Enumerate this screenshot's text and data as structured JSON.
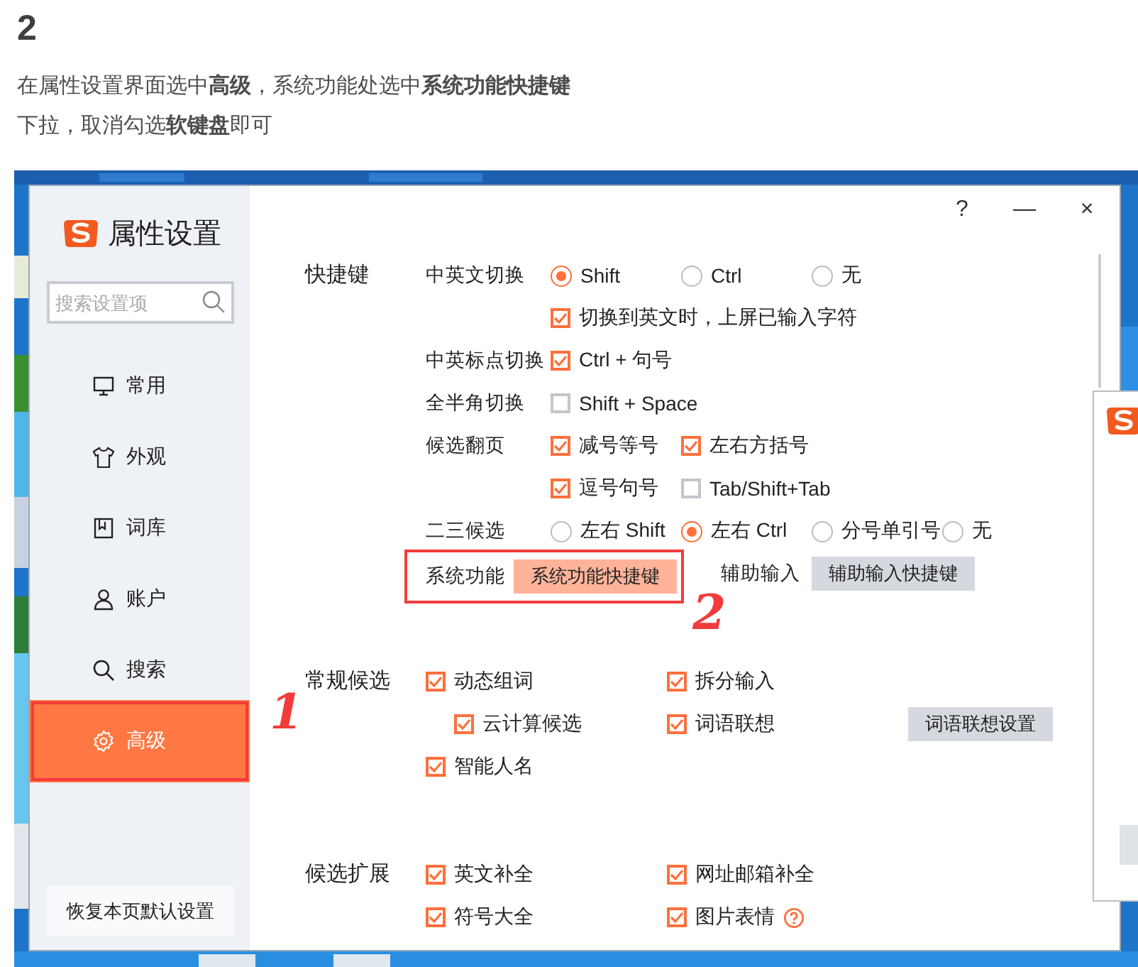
{
  "article": {
    "heading": "2",
    "lines": [
      "在属性设置界面选中**高级**，系统功能处选中**系统功能快捷键**",
      "下拉，取消勾选**软键盘**即可"
    ]
  },
  "dialog": {
    "title": "属性设置",
    "window_buttons": [
      "?",
      "—",
      "×"
    ],
    "search": {
      "placeholder": "搜索设置项"
    },
    "nav": [
      {
        "label": "常用",
        "selected": false,
        "outlined": false
      },
      {
        "label": "外观",
        "selected": false,
        "outlined": false
      },
      {
        "label": "词库",
        "selected": false,
        "outlined": false
      },
      {
        "label": "账户",
        "selected": false,
        "outlined": false
      },
      {
        "label": "搜索",
        "selected": false,
        "outlined": false
      },
      {
        "label": "高级",
        "selected": true,
        "outlined": true
      }
    ],
    "reset_button": "恢复本页默认设置",
    "sections": [
      {
        "label": "快捷键",
        "rows": [
          {
            "label": "中英文切换",
            "options": [
              {
                "kind": "radio",
                "label": "Shift",
                "checked": true
              },
              {
                "kind": "radio",
                "label": "Ctrl",
                "checked": false
              },
              {
                "kind": "radio",
                "label": "无",
                "checked": false
              }
            ]
          },
          {
            "options": [
              {
                "kind": "checkbox",
                "label": "切换到英文时，上屏已输入字符",
                "checked": true
              }
            ]
          },
          {
            "label": "中英标点切换",
            "options": [
              {
                "kind": "checkbox",
                "label": "Ctrl + 句号",
                "checked": true
              }
            ]
          },
          {
            "label": "全半角切换",
            "options": [
              {
                "kind": "checkbox",
                "label": "Shift + Space",
                "checked": false
              }
            ]
          },
          {
            "label": "候选翻页",
            "options": [
              {
                "kind": "checkbox",
                "label": "减号等号",
                "checked": true
              },
              {
                "kind": "checkbox",
                "label": "左右方括号",
                "checked": true
              }
            ]
          },
          {
            "options": [
              {
                "kind": "checkbox",
                "label": "逗号句号",
                "checked": true
              },
              {
                "kind": "checkbox",
                "label": "Tab/Shift+Tab",
                "checked": false
              }
            ]
          },
          {
            "label": "二三候选",
            "options": [
              {
                "kind": "radio",
                "label": "左右 Shift",
                "checked": false
              },
              {
                "kind": "radio",
                "label": "左右 Ctrl",
                "checked": true
              },
              {
                "kind": "radio",
                "label": "分号单引号",
                "checked": false
              },
              {
                "kind": "radio",
                "label": "无",
                "checked": false
              }
            ]
          },
          {
            "label": "系统功能",
            "outlined": true,
            "options": [
              {
                "kind": "button",
                "label": "系统功能快捷键",
                "highlighted": true
              },
              {
                "kind": "text",
                "label": "辅助输入"
              },
              {
                "kind": "button",
                "label": "辅助输入快捷键",
                "highlighted": false
              }
            ]
          }
        ]
      },
      {
        "label": "常规候选",
        "rows": [
          {
            "options": [
              {
                "kind": "checkbox",
                "label": "动态组词",
                "checked": true
              },
              {
                "kind": "checkbox",
                "label": "拆分输入",
                "checked": true
              }
            ]
          },
          {
            "options": [
              {
                "kind": "subcheckbox",
                "label": "云计算候选",
                "checked": true
              },
              {
                "kind": "checkbox",
                "label": "词语联想",
                "checked": true
              },
              {
                "kind": "button",
                "label": "词语联想设置",
                "highlighted": false
              }
            ]
          },
          {
            "options": [
              {
                "kind": "checkbox",
                "label": "智能人名",
                "checked": true
              }
            ]
          }
        ]
      },
      {
        "label": "候选扩展",
        "rows": [
          {
            "options": [
              {
                "kind": "checkbox",
                "label": "英文补全",
                "checked": true
              },
              {
                "kind": "checkbox",
                "label": "网址邮箱补全",
                "checked": true
              }
            ]
          },
          {
            "options": [
              {
                "kind": "checkbox",
                "label": "符号大全",
                "checked": true
              },
              {
                "kind": "checkbox",
                "label": "图片表情",
                "checked": true,
                "help": true
              }
            ]
          }
        ]
      }
    ]
  },
  "annotations": [
    "1",
    "2"
  ]
}
